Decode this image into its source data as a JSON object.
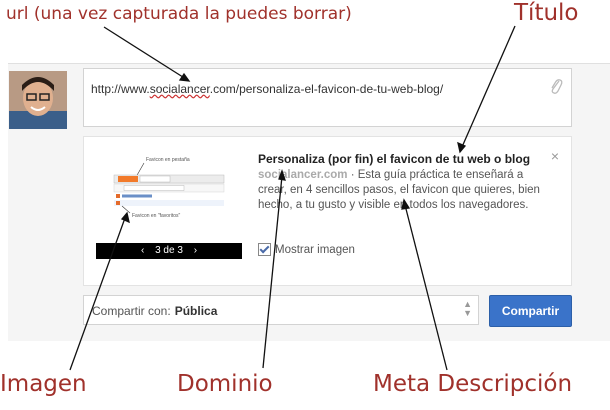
{
  "annotations": {
    "url": "url (una vez capturada la puedes borrar)",
    "titulo": "Título",
    "imagen": "Imagen",
    "dominio": "Dominio",
    "meta": "Meta Descripción"
  },
  "composer": {
    "url_prefix": "http://www.",
    "url_site": "socialancer",
    "url_suffix": ".com/personaliza-el-favicon-de-tu-web-blog/"
  },
  "preview": {
    "title": "Personaliza (por fin) el favicon de tu web o blog",
    "domain": "socialancer.com",
    "description": " · Esta guía práctica te enseñará a crear, en 4 sencillos pasos, el favicon que quieres, bien hecho, a tu gusto y visible en todos los navegadores.",
    "nav_prev": "‹",
    "nav_count": "3 de 3",
    "nav_next": "›",
    "show_image_label": "Mostrar imagen",
    "thumb_label_1": "Favicon en pestaña",
    "thumb_label_2": "Favicon en \"favoritos\"",
    "close_symbol": "×"
  },
  "share": {
    "label": "Compartir con:",
    "value": "Pública",
    "button": "Compartir"
  },
  "icons": [
    "paperclip-icon",
    "close-icon",
    "checkbox-icon",
    "select-arrows-icon",
    "avatar"
  ],
  "colors": {
    "annotation": "#a0312b",
    "button": "#3a73c9"
  }
}
